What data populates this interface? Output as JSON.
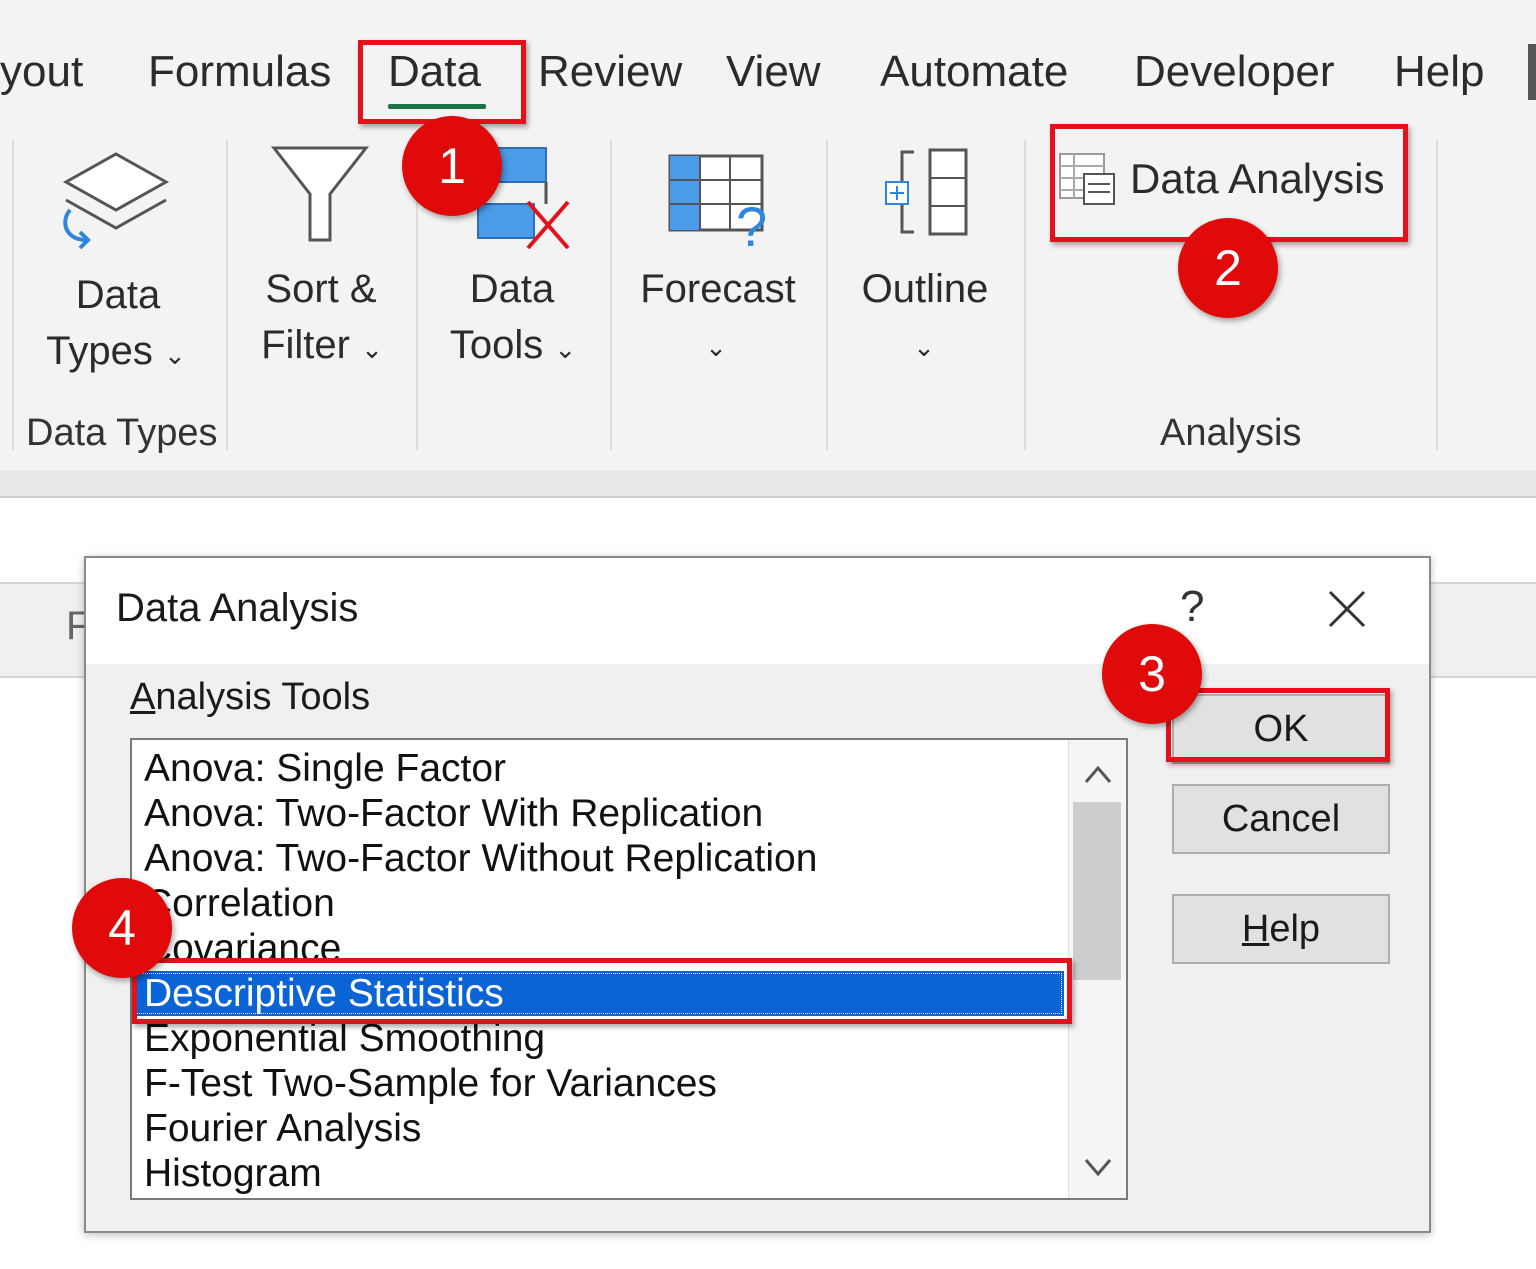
{
  "tabs": {
    "layout_partial": "yout",
    "formulas": "Formulas",
    "data": "Data",
    "review": "Review",
    "view": "View",
    "automate": "Automate",
    "developer": "Developer",
    "help": "Help",
    "active": "Data"
  },
  "ribbon": {
    "data_types_line1": "Data",
    "data_types_line2": "Types",
    "sort_filter_line1": "Sort &",
    "sort_filter_line2": "Filter",
    "data_tools_line1": "Data",
    "data_tools_line2": "Tools",
    "forecast": "Forecast",
    "outline": "Outline",
    "data_analysis": "Data Analysis",
    "group_data_types": "Data Types",
    "group_analysis": "Analysis",
    "chevron": "⌄"
  },
  "sheet": {
    "fragment": "F"
  },
  "dialog": {
    "title": "Data Analysis",
    "help_glyph": "?",
    "tools_label_access": "A",
    "tools_label_rest": "nalysis Tools",
    "items": [
      "Anova: Single Factor",
      "Anova: Two-Factor With Replication",
      "Anova: Two-Factor Without Replication",
      "Correlation",
      "Covariance",
      "Descriptive Statistics",
      "Exponential Smoothing",
      "F-Test Two-Sample for Variances",
      "Fourier Analysis",
      "Histogram"
    ],
    "selected_item": "Descriptive Statistics",
    "ok_label": "OK",
    "cancel_label": "Cancel",
    "help_access": "H",
    "help_rest": "elp"
  },
  "annotations": {
    "step1": "1",
    "step2": "2",
    "step3": "3",
    "step4": "4",
    "highlight_color": "#e3111b",
    "badge_color": "#e10a0a"
  },
  "colors": {
    "selection_blue": "#0a64d6",
    "excel_green": "#1e7145",
    "icon_blue": "#2e86de"
  },
  "icons": [
    "data-types-icon",
    "filter-icon",
    "data-tools-icon",
    "forecast-icon",
    "outline-icon",
    "data-analysis-icon",
    "close-icon",
    "scroll-up-icon",
    "scroll-down-icon"
  ]
}
